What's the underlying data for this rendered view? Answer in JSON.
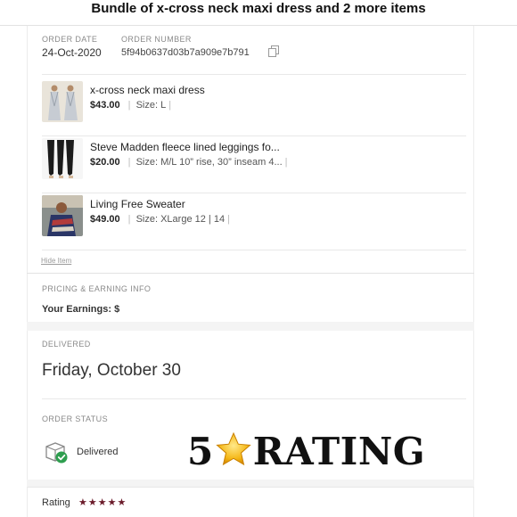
{
  "header": {
    "title": "Bundle of x-cross neck maxi dress and 2 more items"
  },
  "order": {
    "date_label": "ORDER DATE",
    "date": "24-Oct-2020",
    "number_label": "ORDER NUMBER",
    "number": "5f94b0637d03b7a909e7b791"
  },
  "items": [
    {
      "title": "x-cross neck maxi dress",
      "price": "$43.00",
      "size": "Size: L",
      "thumb": "dress"
    },
    {
      "title": "Steve Madden fleece lined leggings fo...",
      "price": "$20.00",
      "size": "Size: M/L 10” rise, 30” inseam 4...",
      "thumb": "leggings"
    },
    {
      "title": "Living Free Sweater",
      "price": "$49.00",
      "size": "Size: XLarge 12 | 14",
      "thumb": "sweater"
    }
  ],
  "hide_item": "Hide Item",
  "pricing": {
    "label": "PRICING & EARNING INFO",
    "earnings": "Your Earnings: $"
  },
  "delivery": {
    "label": "DELIVERED",
    "date": "Friday, October 30"
  },
  "status": {
    "label": "ORDER STATUS",
    "value": "Delivered",
    "icon": "package-check-icon"
  },
  "overlay": {
    "number": "5",
    "word": "RATING"
  },
  "rating": {
    "label": "Rating",
    "stars": "★★★★★",
    "count": 5,
    "max": 5
  },
  "colors": {
    "star": "#6b1b2a",
    "check": "#2e9e4f"
  }
}
